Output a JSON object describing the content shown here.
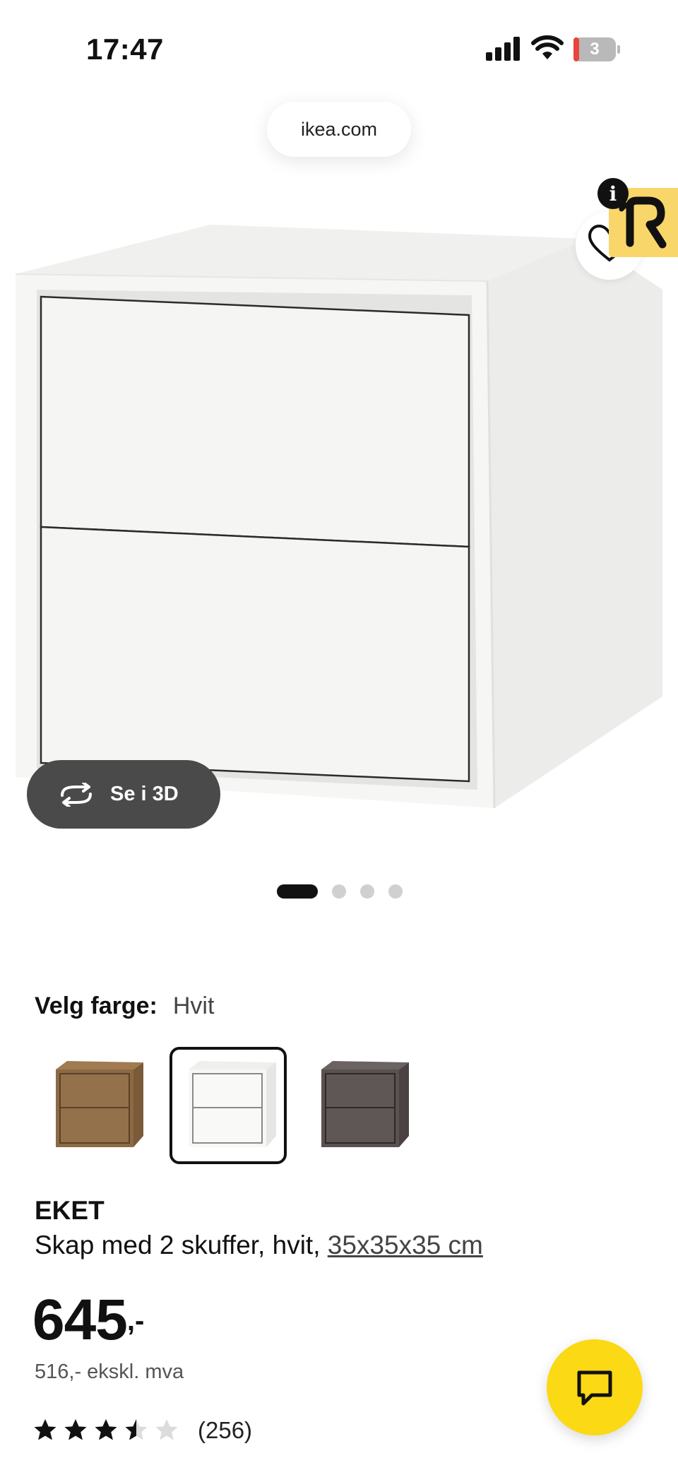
{
  "status_bar": {
    "time": "17:47",
    "battery_level": "3"
  },
  "browser": {
    "url": "ikea.com"
  },
  "gallery": {
    "view_3d_label": "Se i 3D",
    "image_count": 4,
    "active_image": 1
  },
  "color_selector": {
    "label": "Velg farge:",
    "selected": "Hvit",
    "swatch_colors": [
      "#8b6a45",
      "#f7f7f5",
      "#5a5151"
    ]
  },
  "product": {
    "name": "EKET",
    "description": "Skap med 2 skuffer, hvit, ",
    "dimensions": "35x35x35 cm",
    "price": "645",
    "price_suffix": ",-",
    "price_excl_vat": "516,- ekskl. mva",
    "rating": 3.5,
    "rating_max": 5,
    "review_count": "(256)"
  },
  "colors": {
    "accent_yellow": "#fbd914",
    "text": "#111111",
    "muted": "#555555"
  },
  "icons": {
    "chat": "chat-icon",
    "favorite": "heart-icon",
    "rotate": "rotate-3d-icon"
  }
}
